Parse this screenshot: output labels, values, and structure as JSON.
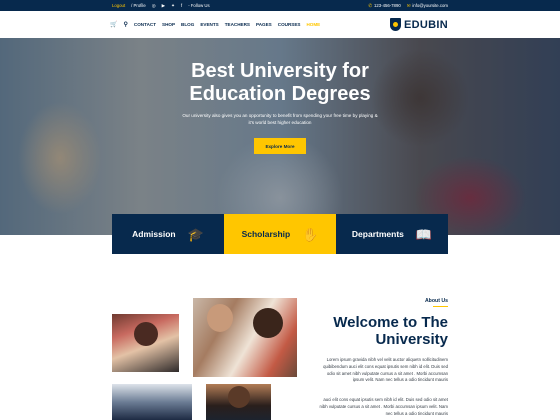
{
  "topbar": {
    "logout": "Logout",
    "profile": "/ Profile",
    "follow": "- Follow Us",
    "phone": "123-456-7890",
    "email": "info@yoursite.com"
  },
  "nav": {
    "items": [
      {
        "label": "CONTACT"
      },
      {
        "label": "SHOP"
      },
      {
        "label": "BLOG"
      },
      {
        "label": "EVENTS"
      },
      {
        "label": "TEACHERS"
      },
      {
        "label": "PAGES"
      },
      {
        "label": "COURSES"
      },
      {
        "label": "HOME"
      }
    ],
    "active": "HOME"
  },
  "brand": {
    "name": "EDUBIN"
  },
  "hero": {
    "title_line1": "Best University for",
    "title_line2": "Education Degrees",
    "subtitle": "Our university also gives you an opportunity to benefit from spending your free time by playing & it's world best higher education",
    "cta": "Explore More"
  },
  "features": [
    {
      "label": "Admission",
      "icon": "graduation-cap-icon"
    },
    {
      "label": "Scholarship",
      "icon": "hand-coin-icon"
    },
    {
      "label": "Departments",
      "icon": "book-icon"
    }
  ],
  "about": {
    "tag": "About Us",
    "title_line1": "Welcome to The",
    "title_line2": "University",
    "para1": "Lorem ipsum gravida nibh vel velit auctor aliquetn sollicitudinem quibibendum auci elit cons equat ipsutis sem nibh id elit. Duis sed odio sit amet nibh vulputate cursus a sit amet . Morbi accumsan ipsum velit. Nam nec tellus a odio tincidunt mauris",
    "para2": "auci elit cons equat ipsutis sem nibh id elit. Duis sed odio sit amet nibh vulputate cursus a sit amet . Morbi accumsan ipsum velit. Nam nec tellus a odio tincidunt mauris"
  },
  "colors": {
    "primary": "#07294d",
    "accent": "#ffc600"
  }
}
